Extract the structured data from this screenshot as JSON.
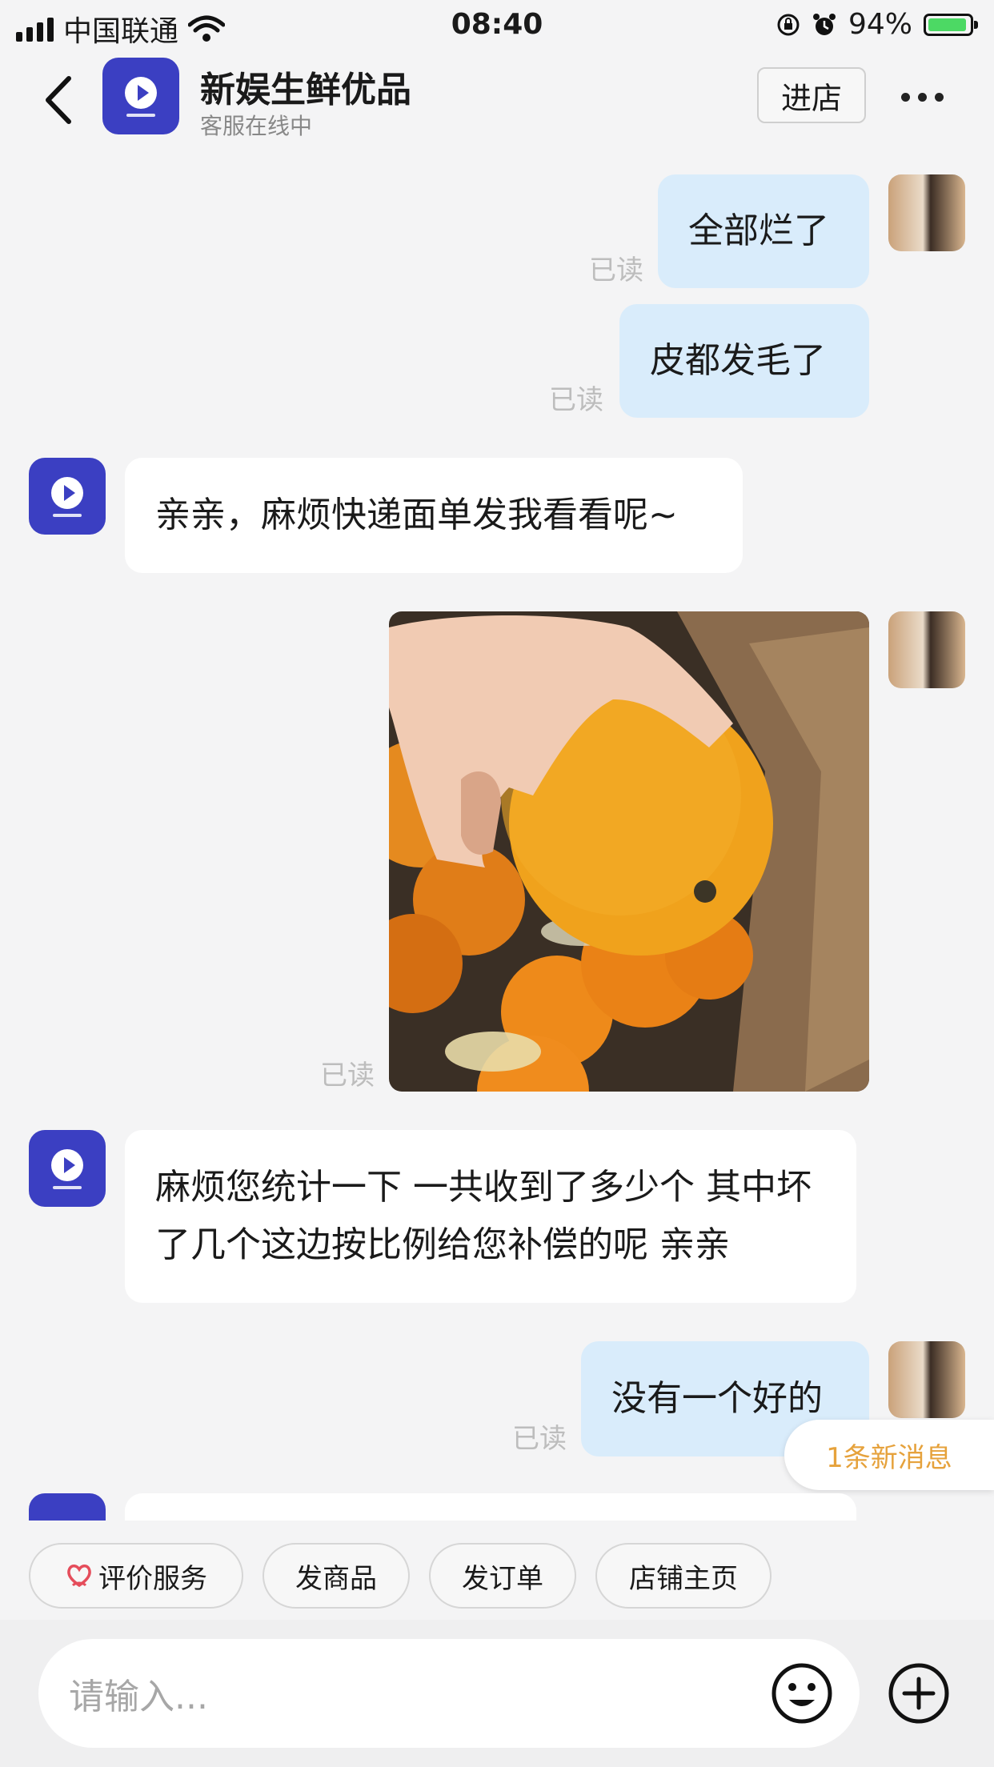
{
  "status_bar": {
    "carrier": "中国联通",
    "time": "08:40",
    "battery": "94%",
    "battery_level": 0.94
  },
  "header": {
    "title": "新娱生鲜优品",
    "subtitle": "客服在线中",
    "enter_store": "进店"
  },
  "messages": [
    {
      "from": "me",
      "text": "全部烂了",
      "read": "已读"
    },
    {
      "from": "me",
      "text": "皮都发毛了",
      "read": "已读"
    },
    {
      "from": "shop",
      "text": "亲亲，麻烦快递面单发我看看呢~"
    },
    {
      "from": "me",
      "type": "image",
      "read": "已读"
    },
    {
      "from": "shop",
      "text": "麻烦您统计一下 一共收到了多少个 其中坏了几个这边按比例给您补偿的呢 亲亲"
    },
    {
      "from": "me",
      "text": "没有一个好的",
      "read": "已读"
    }
  ],
  "new_message_badge": "1条新消息",
  "quick_actions": [
    "评价服务",
    "发商品",
    "发订单",
    "店铺主页"
  ],
  "input": {
    "placeholder": "请输入..."
  },
  "colors": {
    "brand": "#3b3fc2",
    "my_bubble": "#d9ecfb",
    "accent": "#e6a23c"
  }
}
